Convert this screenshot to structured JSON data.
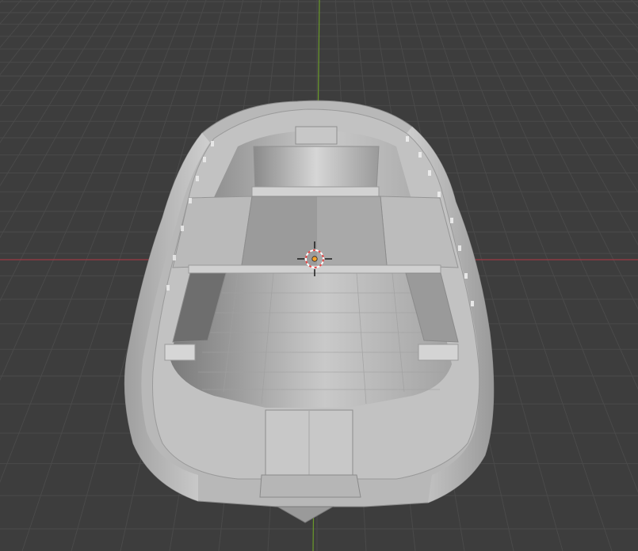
{
  "viewport": {
    "background_color": "#3d3d3d",
    "grid_color": "#4a4a4a",
    "x_axis_color": "#9c3a44",
    "y_axis_color": "#6a9a2a",
    "cursor_icon": "3d-cursor-icon",
    "origin_icon": "object-origin-icon",
    "origin_color": "#f4a12a"
  },
  "model": {
    "name_icon": "boat-hull-icon",
    "hull_color": "#bdbdbd"
  }
}
